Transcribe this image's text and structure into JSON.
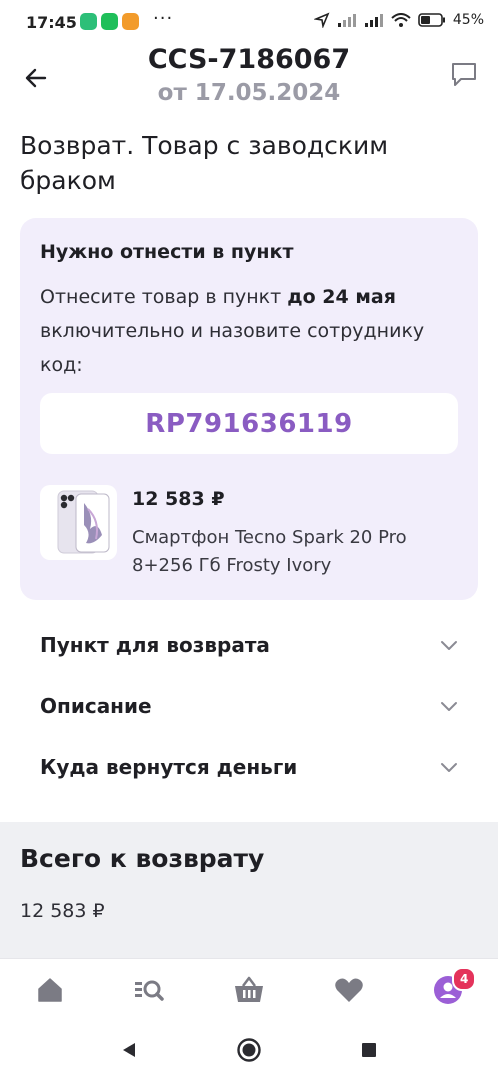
{
  "status_bar": {
    "time": "17:45",
    "more": "···",
    "battery": "45%"
  },
  "header": {
    "order_id": "CCS-7186067",
    "order_date": "от 17.05.2024"
  },
  "page_title": "Возврат. Товар с заводским браком",
  "card": {
    "title": "Нужно отнести в пункт",
    "text_before": "Отнесите товар в пункт ",
    "text_bold": "до 24 мая",
    "text_after": " включительно и назовите сотруднику код:",
    "code": "RP791636119",
    "product_price": "12 583 ₽",
    "product_name": "Смартфон Tecno Spark 20 Pro 8+256 Гб Frosty Ivory"
  },
  "accordions": [
    {
      "label": "Пункт для возврата"
    },
    {
      "label": "Описание"
    },
    {
      "label": "Куда вернутся деньги"
    }
  ],
  "summary": {
    "title": "Всего к возврату",
    "value": "12 583 ₽"
  },
  "bottom_nav": {
    "items": [
      {
        "icon": "home-icon"
      },
      {
        "icon": "catalog-search-icon"
      },
      {
        "icon": "cart-basket-icon"
      },
      {
        "icon": "heart-icon"
      },
      {
        "icon": "profile-icon",
        "badge": "4"
      }
    ]
  },
  "colors": {
    "accent": "#8a5cc2",
    "card_bg": "#f2eefb",
    "summary_bg": "#eff0f3",
    "badge": "#e4335b",
    "nav_icon": "#7b7b84",
    "profile_icon": "#9b5fd6"
  }
}
